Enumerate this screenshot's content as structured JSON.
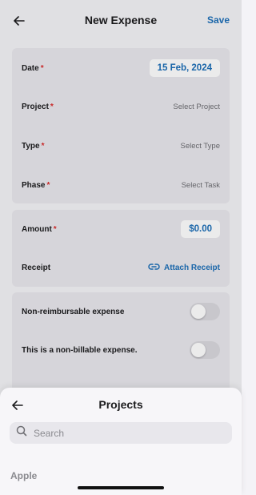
{
  "header": {
    "title": "New Expense",
    "save_label": "Save"
  },
  "details": {
    "date": {
      "label": "Date",
      "value": "15 Feb, 2024"
    },
    "project": {
      "label": "Project",
      "placeholder": "Select Project"
    },
    "type": {
      "label": "Type",
      "placeholder": "Select Type"
    },
    "phase": {
      "label": "Phase",
      "placeholder": "Select Task"
    }
  },
  "amount_section": {
    "amount": {
      "label": "Amount",
      "value": "$0.00"
    },
    "receipt": {
      "label": "Receipt",
      "action": "Attach Receipt"
    }
  },
  "toggles": [
    {
      "label": "Non-reimbursable expense",
      "on": false
    },
    {
      "label": "This is a non-billable expense.",
      "on": false
    }
  ],
  "sheet": {
    "title": "Projects",
    "search_placeholder": "Search",
    "section": "Apple"
  },
  "required_mark": "*",
  "colors": {
    "accent": "#1d6fb8",
    "required": "#d92d2d"
  }
}
